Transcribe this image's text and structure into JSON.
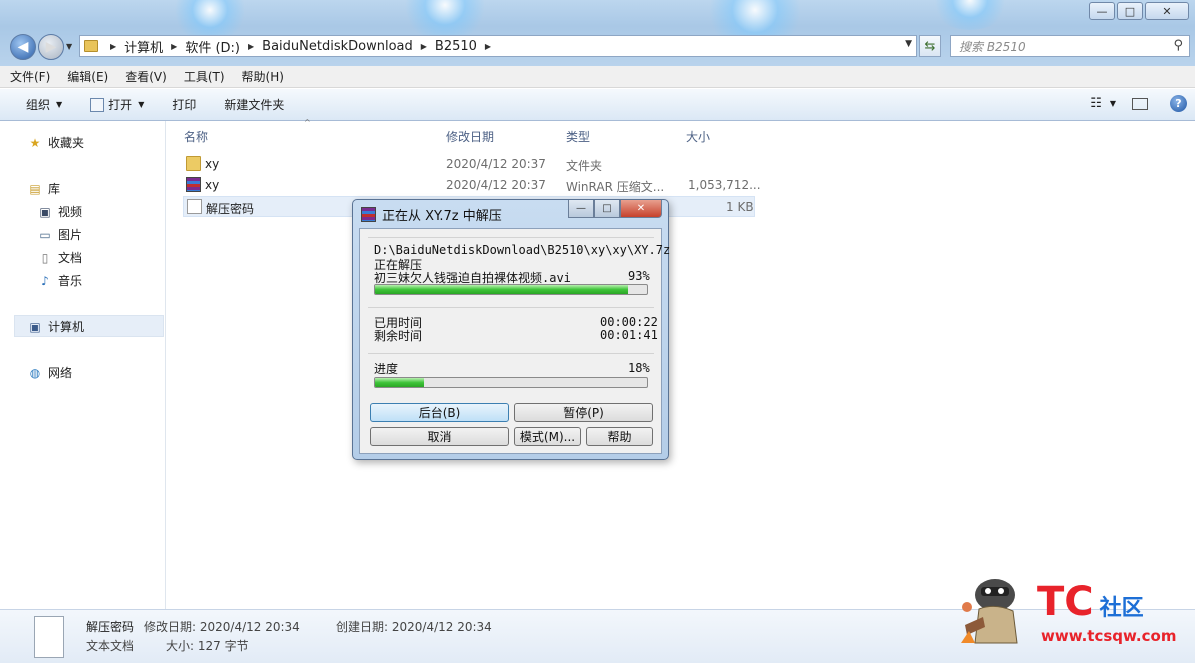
{
  "window": {
    "minimize": "—",
    "maximize": "□",
    "close": "✕"
  },
  "address": {
    "crumbs": [
      "计算机",
      "软件 (D:)",
      "BaiduNetdiskDownload",
      "B2510"
    ],
    "search_placeholder": "搜索 B2510"
  },
  "menu": [
    "文件(F)",
    "编辑(E)",
    "查看(V)",
    "工具(T)",
    "帮助(H)"
  ],
  "toolbar": {
    "organize": "组织",
    "open": "打开",
    "print": "打印",
    "new_folder": "新建文件夹"
  },
  "nav": {
    "favorites": "收藏夹",
    "libraries": "库",
    "videos": "视频",
    "pictures": "图片",
    "documents": "文档",
    "music": "音乐",
    "computer": "计算机",
    "network": "网络"
  },
  "columns": {
    "name": "名称",
    "modified": "修改日期",
    "type": "类型",
    "size": "大小"
  },
  "files": [
    {
      "name": "xy",
      "modified": "2020/4/12 20:37",
      "type": "文件夹",
      "size": "",
      "icon": "folder-icon"
    },
    {
      "name": "xy",
      "modified": "2020/4/12 20:37",
      "type": "WinRAR 压缩文...",
      "size": "1,053,712...",
      "icon": "winrar-icon"
    },
    {
      "name": "解压密码",
      "modified": "",
      "type": "",
      "size": "1 KB",
      "icon": "text-file-icon"
    }
  ],
  "status": {
    "name": "解压密码",
    "modified_label": "修改日期: 2020/4/12 20:34",
    "created_label": "创建日期: 2020/4/12 20:34",
    "type": "文本文档",
    "size_label": "大小: 127 字节"
  },
  "dialog": {
    "title": "正在从 XY.7z 中解压",
    "path": "D:\\BaiduNetdiskDownload\\B2510\\xy\\xy\\XY.7z",
    "action": "正在解压",
    "current_file": "初三妹欠人钱强迫自拍裸体视频.avi",
    "file_percent": "93%",
    "file_progress": 0.93,
    "elapsed_label": "已用时间",
    "elapsed": "00:00:22",
    "remaining_label": "剩余时间",
    "remaining": "00:01:41",
    "progress_label": "进度",
    "total_percent": "18%",
    "total_progress": 0.18,
    "btn_background": "后台(B)",
    "btn_pause": "暂停(P)",
    "btn_cancel": "取消",
    "btn_mode": "模式(M)...",
    "btn_help": "帮助"
  },
  "watermark": {
    "logo": "TC",
    "logo_suffix": "社区",
    "url": "www.tcsqw.com"
  }
}
